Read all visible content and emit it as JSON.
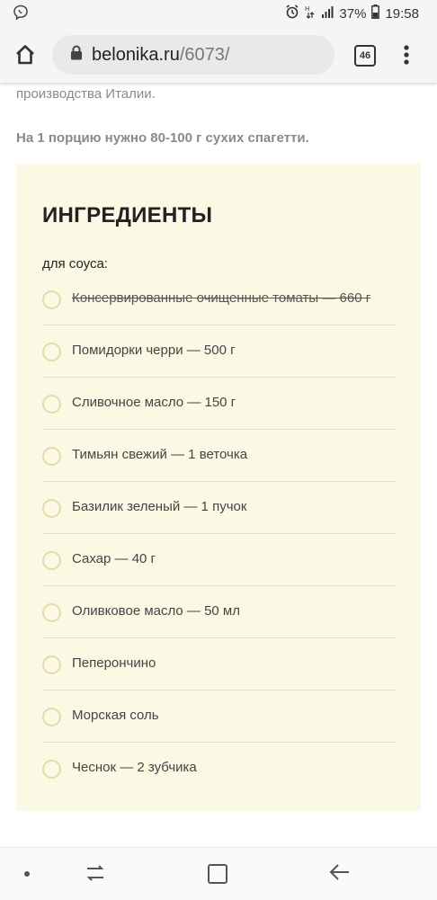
{
  "status_bar": {
    "battery": "37%",
    "time": "19:58"
  },
  "browser": {
    "url_domain": "belonika.ru",
    "url_path": "/6073/",
    "tab_count": "46"
  },
  "article": {
    "cut_text": "производства Италии.",
    "portion_note": "На 1 порцию нужно 80-100 г сухих спагетти."
  },
  "ingredients": {
    "title": "ИНГРЕДИЕНТЫ",
    "subtitle": "для соуса:",
    "items": [
      {
        "label": "Консервированные очищенные томаты — 660 г",
        "checked": true
      },
      {
        "label": "Помидорки черри — 500 г",
        "checked": false
      },
      {
        "label": "Сливочное масло — 150 г",
        "checked": false
      },
      {
        "label": "Тимьян свежий — 1 веточка",
        "checked": false
      },
      {
        "label": "Базилик зеленый — 1 пучок",
        "checked": false
      },
      {
        "label": "Сахар — 40 г",
        "checked": false
      },
      {
        "label": "Оливковое масло — 50 мл",
        "checked": false
      },
      {
        "label": "Пеперончино",
        "checked": false
      },
      {
        "label": "Морская соль",
        "checked": false
      },
      {
        "label": "Чеснок — 2 зубчика",
        "checked": false
      }
    ]
  },
  "colors": {
    "box_background": "#fbf9e4",
    "circle_border": "#e3dcaa"
  }
}
